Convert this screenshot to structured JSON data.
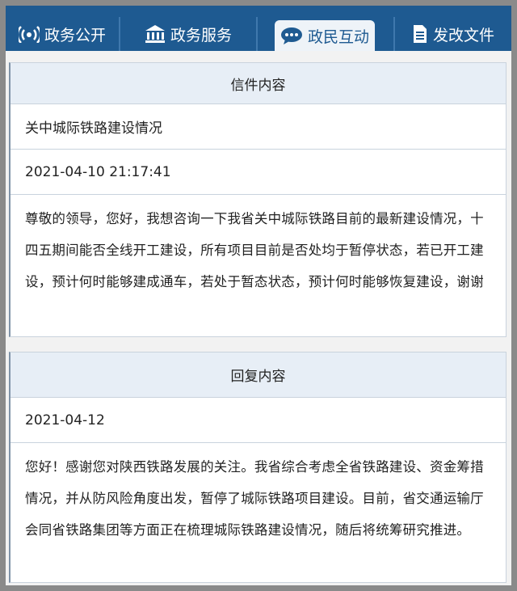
{
  "tabs": [
    {
      "label": "政务公开",
      "icon": "broadcast-icon"
    },
    {
      "label": "政务服务",
      "icon": "bank-icon"
    },
    {
      "label": "政民互动",
      "icon": "chat-bubble-icon",
      "active": true
    },
    {
      "label": "发改文件",
      "icon": "document-icon"
    }
  ],
  "letter": {
    "section_title": "信件内容",
    "subject": "关中城际铁路建设情况",
    "timestamp": "2021-04-10 21:17:41",
    "body": "尊敬的领导，您好，我想咨询一下我省关中城际铁路目前的最新建设情况，十四五期间能否全线开工建设，所有项目目前是否处均于暂停状态，若已开工建设，预计何时能够建成通车，若处于暂态状态，预计何时能够恢复建设，谢谢"
  },
  "reply": {
    "section_title": "回复内容",
    "date": "2021-04-12",
    "body": "您好！感谢您对陕西铁路发展的关注。我省综合考虑全省铁路建设、资金筹措情况，并从防风险角度出发，暂停了城际铁路项目建设。目前，省交通运输厅会同省铁路集团等方面正在梳理城际铁路建设情况，随后将统筹研究推进。"
  },
  "colors": {
    "tab_bar": "#1e5a91",
    "tab_active_bg": "#eef3f8",
    "header_bg": "#e7eef6",
    "border": "#c9d3dd"
  }
}
